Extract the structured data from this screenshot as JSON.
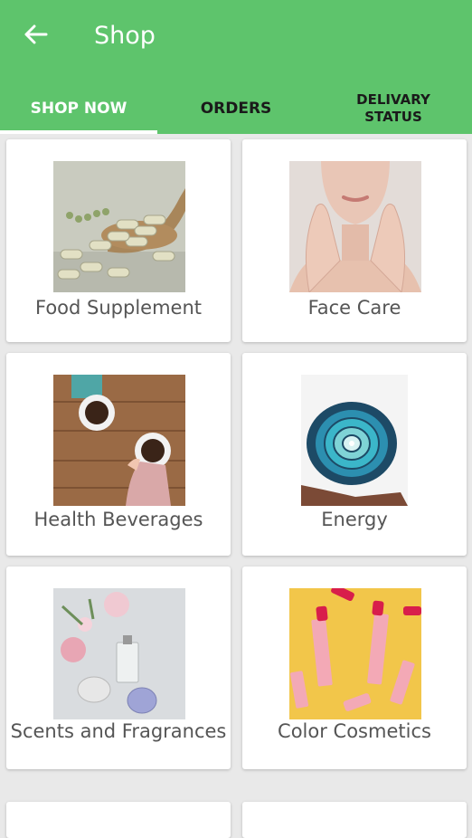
{
  "header": {
    "title": "Shop"
  },
  "tabs": [
    {
      "label": "SHOP NOW",
      "active": true
    },
    {
      "label": "ORDERS",
      "active": false
    },
    {
      "label": "DELIVARY STATUS",
      "active": false
    }
  ],
  "categories": [
    {
      "label": "Food Supplement",
      "icon": "supplement-capsules-image"
    },
    {
      "label": "Face Care",
      "icon": "face-care-image"
    },
    {
      "label": "Health Beverages",
      "icon": "coffee-cups-image"
    },
    {
      "label": "Energy",
      "icon": "energy-disc-image"
    },
    {
      "label": "Scents and Fragrances",
      "icon": "perfume-flowers-image"
    },
    {
      "label": "Color Cosmetics",
      "icon": "lipsticks-image"
    }
  ],
  "colors": {
    "appbar": "#5ec46c",
    "background": "#e9e9e9",
    "card": "#ffffff",
    "label": "#555555"
  }
}
